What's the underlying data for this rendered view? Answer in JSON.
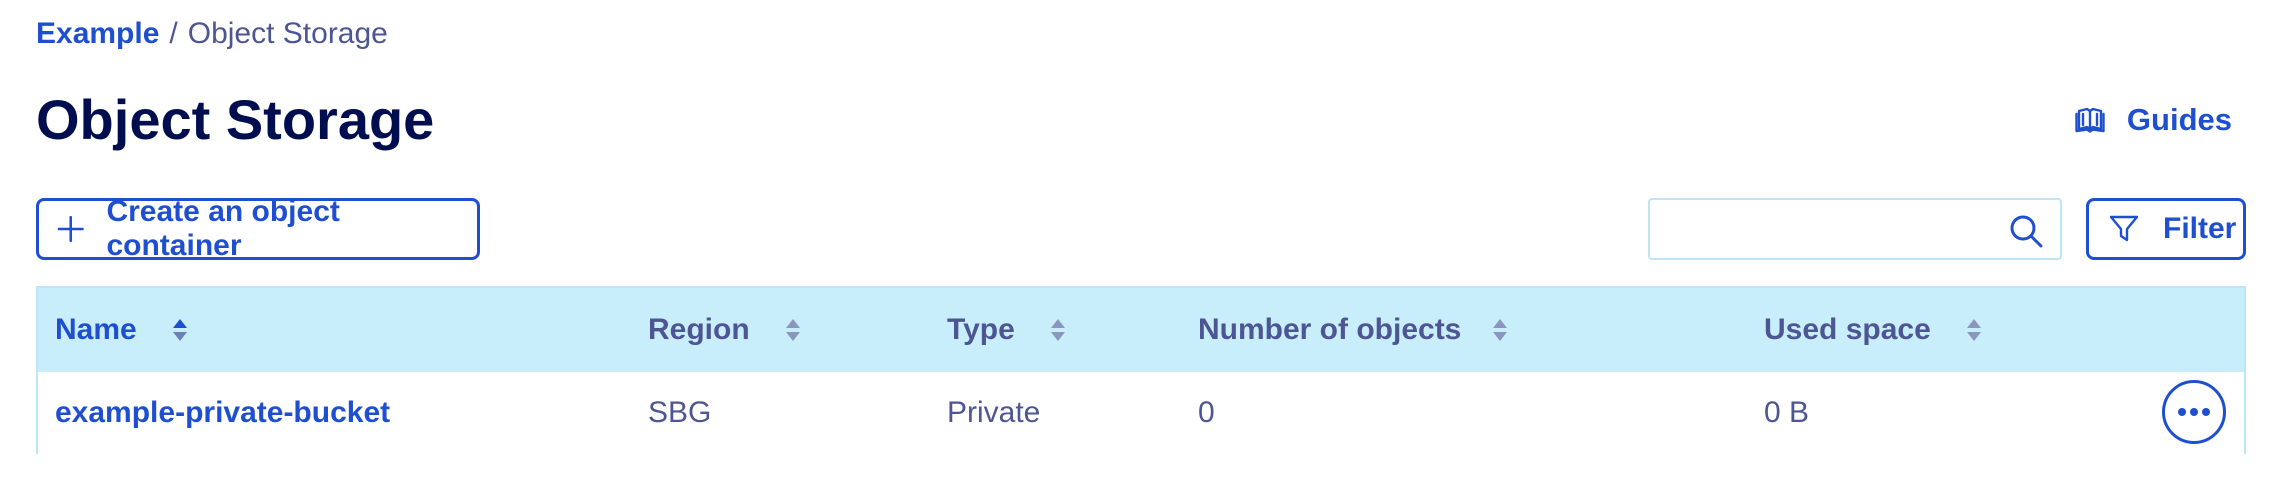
{
  "breadcrumb": {
    "root": "Example",
    "separator": "/",
    "current": "Object Storage"
  },
  "page": {
    "title": "Object Storage"
  },
  "guides": {
    "label": "Guides",
    "icon": "book-icon"
  },
  "toolbar": {
    "create_label": "Create an object container",
    "create_icon": "plus-icon",
    "search_placeholder": "",
    "search_value": "",
    "search_icon": "search-icon",
    "filter_label": "Filter",
    "filter_icon": "filter-icon"
  },
  "table": {
    "columns": [
      {
        "label": "Name",
        "sorted": true
      },
      {
        "label": "Region",
        "sorted": false
      },
      {
        "label": "Type",
        "sorted": false
      },
      {
        "label": "Number of objects",
        "sorted": false
      },
      {
        "label": "Used space",
        "sorted": false
      }
    ],
    "rows": [
      {
        "name": "example-private-bucket",
        "region": "SBG",
        "type": "Private",
        "objects": "0",
        "used_space": "0 B",
        "actions_icon": "more-horizontal-icon"
      }
    ]
  },
  "colors": {
    "primary": "#1f4fd1",
    "title": "#000e4f",
    "text": "#4d5693",
    "header_bg": "#c9eefb",
    "border": "#bde4f7"
  }
}
